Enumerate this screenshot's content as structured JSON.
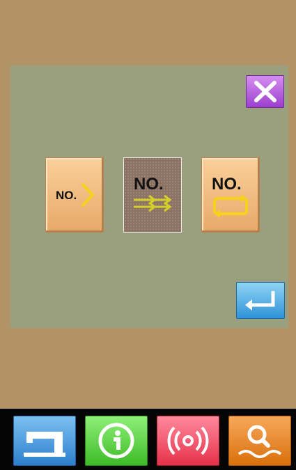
{
  "mode_buttons": [
    {
      "label": "NO.",
      "icon": "diamond-arrow-icon",
      "state": "normal"
    },
    {
      "label": "NO.",
      "icon": "double-arrow-icon",
      "state": "selected"
    },
    {
      "label": "NO.",
      "icon": "loop-arrows-icon",
      "state": "normal"
    }
  ],
  "dialog": {
    "close_icon": "close-icon",
    "confirm_icon": "enter-icon"
  },
  "footer": {
    "buttons": [
      {
        "icon": "sewing-machine-icon",
        "color": "#3a8fdc"
      },
      {
        "icon": "info-icon",
        "color": "#4fcf35"
      },
      {
        "icon": "signal-icon",
        "color": "#f04a61"
      },
      {
        "icon": "search-icon",
        "color": "#e9871e"
      }
    ]
  },
  "colors": {
    "background": "#b19365",
    "panel": "#9aa07d",
    "footer": "#050505"
  }
}
